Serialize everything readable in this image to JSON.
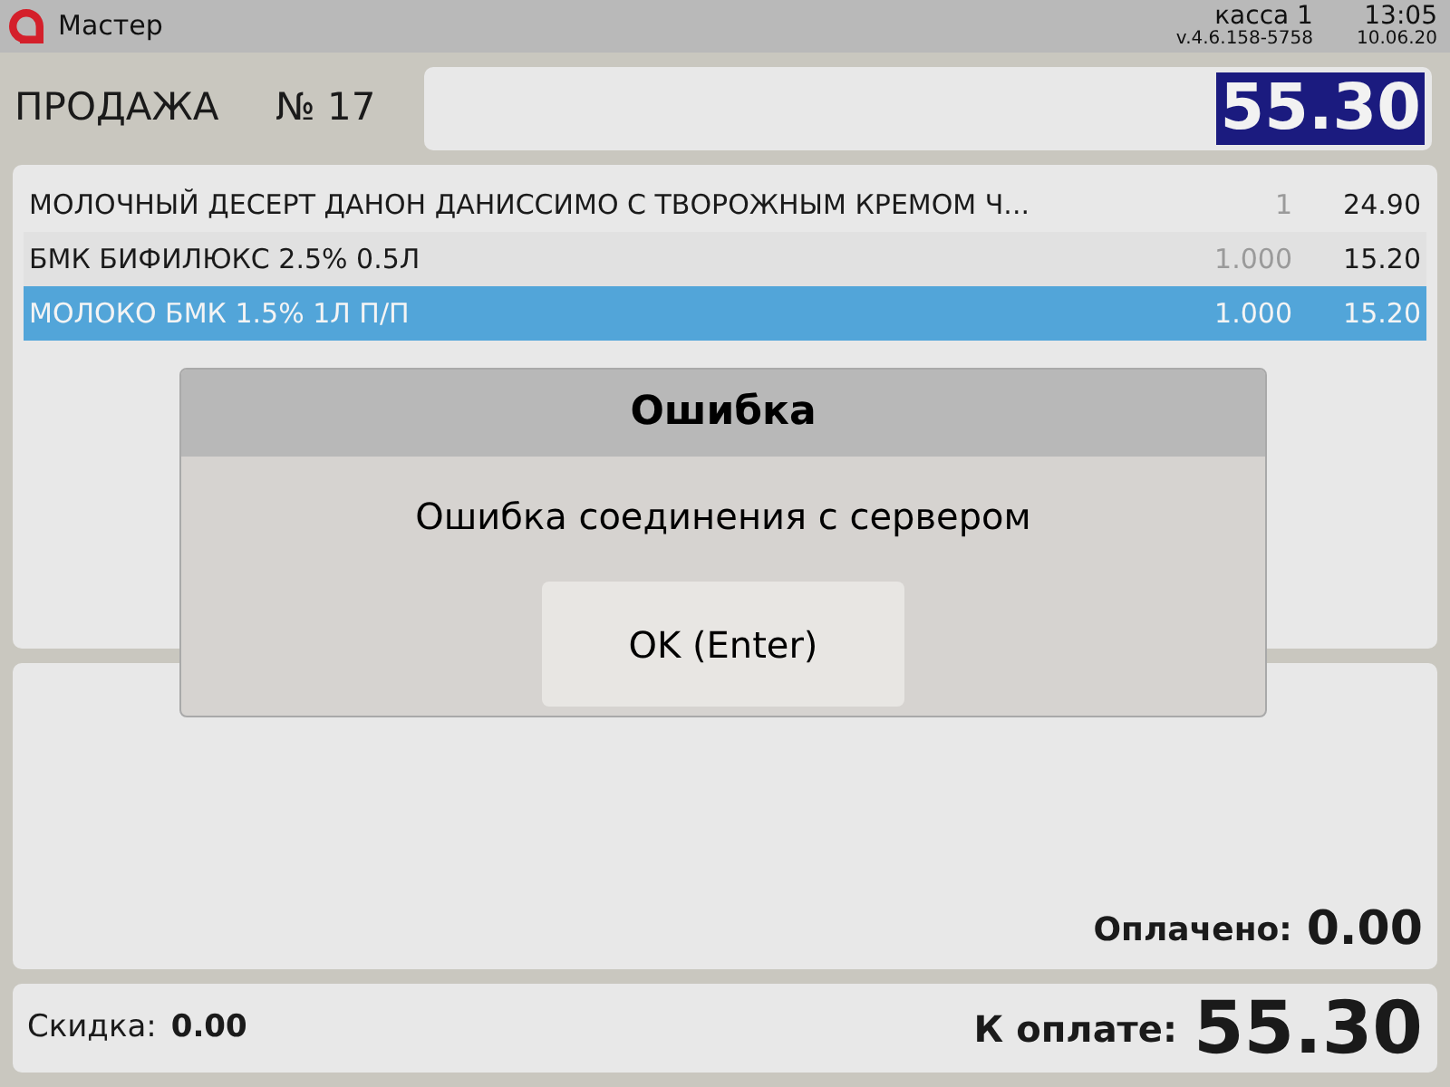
{
  "window": {
    "title": "Мастер",
    "register": "касса 1",
    "version": "v.4.6.158-5758",
    "time": "13:05",
    "date": "10.06.20"
  },
  "sale": {
    "label": "ПРОДАЖА",
    "number": "№ 17",
    "total": "55.30"
  },
  "items": [
    {
      "name": "МОЛОЧНЫЙ ДЕСЕРТ ДАНОН ДАНИССИМО С ТВОРОЖНЫМ КРЕМОМ Ч...",
      "quantity": "1",
      "price": "24.90",
      "selected": false
    },
    {
      "name": "БМК БИФИЛЮКС 2.5% 0.5Л",
      "quantity": "1.000",
      "price": "15.20",
      "selected": false
    },
    {
      "name": "МОЛОКО БМК 1.5% 1Л П/П",
      "quantity": "1.000",
      "price": "15.20",
      "selected": true
    }
  ],
  "payments": {
    "paid_label": "Оплачено:",
    "paid": "0.00"
  },
  "footer": {
    "discount_label": "Скидка:",
    "discount": "0.00",
    "due_label": "К оплате:",
    "due": "55.30"
  },
  "dialog": {
    "title": "Ошибка",
    "message": "Ошибка соединения с сервером",
    "buttons": [
      "OK (Enter)"
    ]
  }
}
